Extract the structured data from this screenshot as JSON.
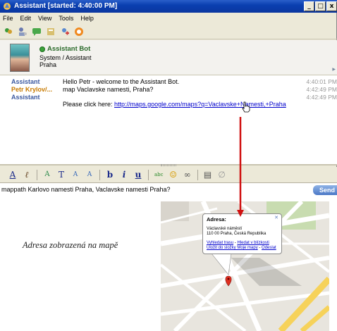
{
  "window": {
    "title": "Assistant [started: 4:40:00 PM]",
    "controls": [
      "_",
      "□",
      "x"
    ]
  },
  "menu": [
    "File",
    "Edit",
    "View",
    "Tools",
    "Help"
  ],
  "contact": {
    "name": "Assistant Bot",
    "group": "System / Assistant",
    "city": "Praha",
    "status_color": "#3aa23a"
  },
  "chat": {
    "messages": [
      {
        "sender": "Assistant",
        "text": "Hello Petr - welcome to the Assistant Bot.",
        "time": "4:40:01 PM",
        "role": "bot"
      },
      {
        "sender": "Petr Krylov/...",
        "text": "map Vaclavske namesti, Praha?",
        "time": "4:42:49 PM",
        "role": "user"
      },
      {
        "sender": "Assistant",
        "text": "",
        "time": "4:42:49 PM",
        "role": "bot"
      }
    ],
    "link_prefix": "Please click here: ",
    "link_url": "http://maps.google.com/maps?q=Vaclavske+Namesti,+Praha"
  },
  "format_toolbar": [
    "A",
    "ℓ",
    "A",
    "T",
    "A",
    "A",
    "b",
    "i",
    "u",
    "abc",
    "☺",
    "∞",
    "▤",
    "∅"
  ],
  "input": {
    "value": "mappath Karlovo namesti Praha, Vaclavske namesti Praha?",
    "send_label": "Send"
  },
  "caption": "Adresa zobrazená na mapě",
  "map_popup": {
    "title": "Adresa:",
    "street": "Václavské náměstí",
    "city": "110 00 Praha, Česká Republika",
    "link_route": "Vyhledat trasu",
    "link_nearby": "Hledat v blízkosti",
    "link_save": "Uložit do složky Moje mapy",
    "link_send": "Odeslat"
  },
  "colors": {
    "titlebar": "#0b37a0",
    "arrow": "#d01010",
    "link": "#0000cc"
  }
}
